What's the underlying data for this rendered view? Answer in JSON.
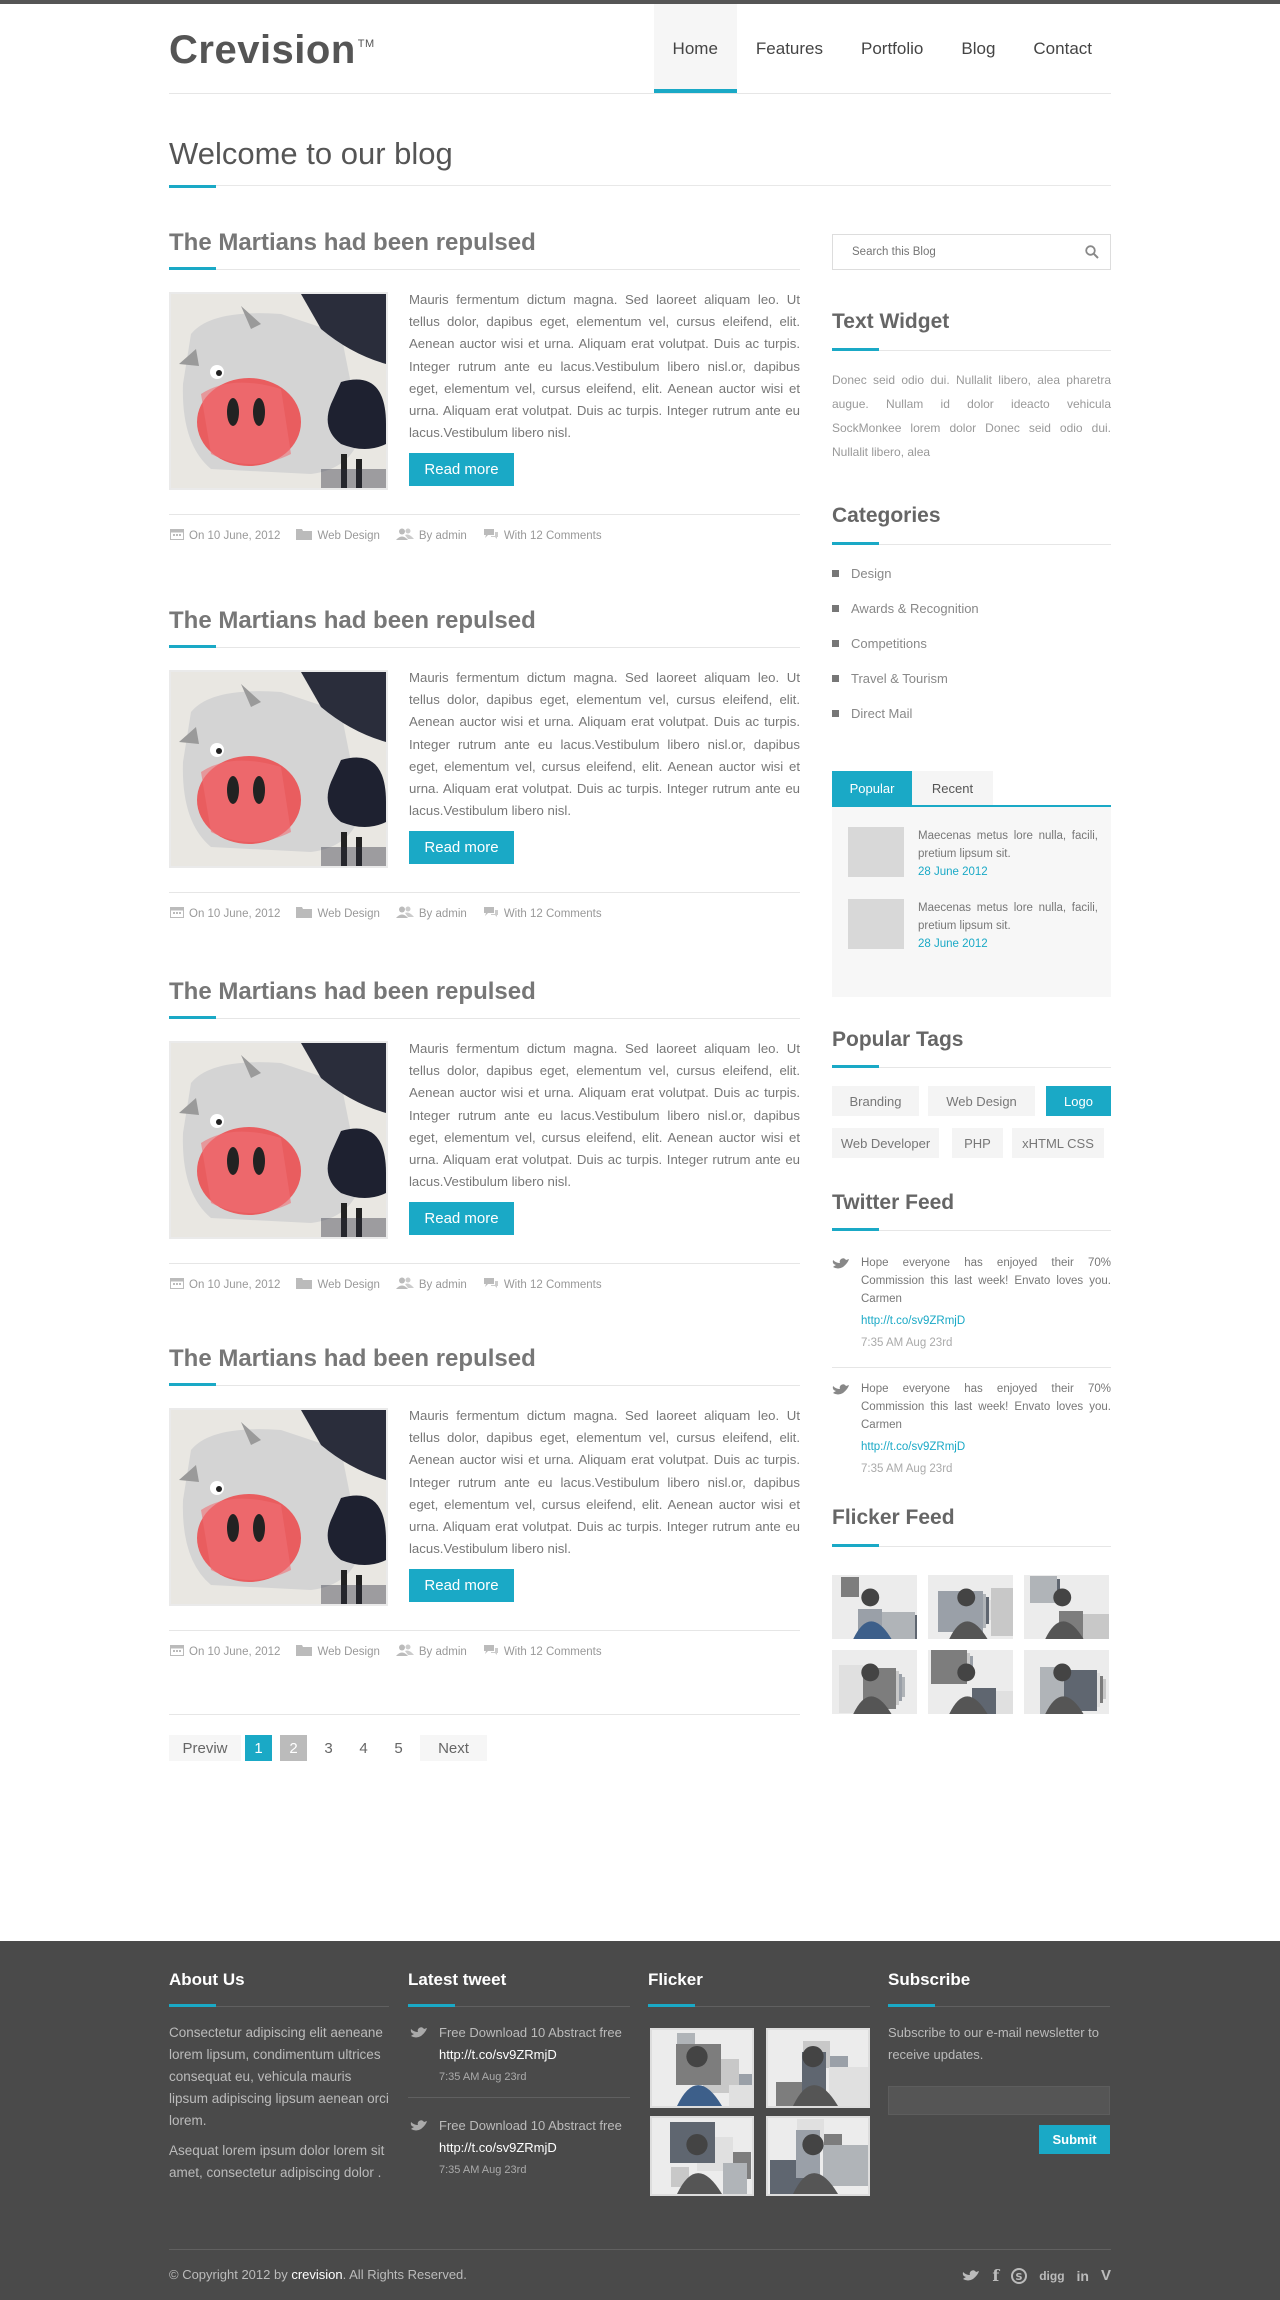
{
  "header": {
    "logo": "Crevision",
    "logo_tm": "TM",
    "nav": [
      "Home",
      "Features",
      "Portfolio",
      "Blog",
      "Contact"
    ],
    "active_nav": "Home"
  },
  "page": {
    "title": "Welcome to our blog"
  },
  "posts": [
    {
      "title": "The Martians had been repulsed",
      "excerpt": "Mauris fermentum dictum magna. Sed laoreet aliquam leo. Ut tellus dolor, dapibus eget, elementum vel, cursus eleifend, elit. Aenean auctor wisi et urna. Aliquam erat volutpat. Duis ac turpis. Integer rutrum ante eu lacus.Vestibulum libero nisl.or, dapibus eget, elementum vel, cursus eleifend, elit. Aenean auctor wisi et urna. Aliquam erat volutpat. Duis ac turpis. Integer rutrum ante eu lacus.Vestibulum libero nisl.",
      "button": "Read more",
      "date": "On 10 June, 2012",
      "category": "Web Design",
      "author": "By admin",
      "comments": "With 12 Comments"
    },
    {
      "title": "The Martians had been repulsed",
      "excerpt": "Mauris fermentum dictum magna. Sed laoreet aliquam leo. Ut tellus dolor, dapibus eget, elementum vel, cursus eleifend, elit. Aenean auctor wisi et urna. Aliquam erat volutpat. Duis ac turpis. Integer rutrum ante eu lacus.Vestibulum libero nisl.or, dapibus eget, elementum vel, cursus eleifend, elit. Aenean auctor wisi et urna. Aliquam erat volutpat. Duis ac turpis. Integer rutrum ante eu lacus.Vestibulum libero nisl.",
      "button": "Read more",
      "date": "On 10 June, 2012",
      "category": "Web Design",
      "author": "By admin",
      "comments": "With 12 Comments"
    },
    {
      "title": "The Martians had been repulsed",
      "excerpt": "Mauris fermentum dictum magna. Sed laoreet aliquam leo. Ut tellus dolor, dapibus eget, elementum vel, cursus eleifend, elit. Aenean auctor wisi et urna. Aliquam erat volutpat. Duis ac turpis. Integer rutrum ante eu lacus.Vestibulum libero nisl.or, dapibus eget, elementum vel, cursus eleifend, elit. Aenean auctor wisi et urna. Aliquam erat volutpat. Duis ac turpis. Integer rutrum ante eu lacus.Vestibulum libero nisl.",
      "button": "Read more",
      "date": "On 10 June, 2012",
      "category": "Web Design",
      "author": "By admin",
      "comments": "With 12 Comments"
    },
    {
      "title": "The Martians had been repulsed",
      "excerpt": "Mauris fermentum dictum magna. Sed laoreet aliquam leo. Ut tellus dolor, dapibus eget, elementum vel, cursus eleifend, elit. Aenean auctor wisi et urna. Aliquam erat volutpat. Duis ac turpis. Integer rutrum ante eu lacus.Vestibulum libero nisl.or, dapibus eget, elementum vel, cursus eleifend, elit. Aenean auctor wisi et urna. Aliquam erat volutpat. Duis ac turpis. Integer rutrum ante eu lacus.Vestibulum libero nisl.",
      "button": "Read more",
      "date": "On 10 June, 2012",
      "category": "Web Design",
      "author": "By admin",
      "comments": "With 12 Comments"
    }
  ],
  "pagination": {
    "prev": "Previw",
    "pages": [
      "1",
      "2",
      "3",
      "4",
      "5"
    ],
    "next": "Next",
    "current": "1"
  },
  "sidebar": {
    "search_placeholder": "Search this Blog",
    "text_widget": {
      "title": "Text Widget",
      "body": "Donec seid odio dui. Nullalit libero, alea pharetra augue. Nullam id dolor ideacto vehicula SockMonkee lorem dolor Donec seid odio dui. Nullalit libero, alea"
    },
    "categories": {
      "title": "Categories",
      "items": [
        "Design",
        "Awards & Recognition",
        "Competitions",
        "Travel & Tourism",
        "Direct Mail"
      ]
    },
    "tabs": {
      "labels": [
        "Popular",
        "Recent"
      ],
      "posts": [
        {
          "text": "Maecenas metus lore nulla, facili, pretium lipsum sit.",
          "date": "28 June 2012"
        },
        {
          "text": "Maecenas metus lore nulla, facili, pretium lipsum sit.",
          "date": "28 June 2012"
        }
      ]
    },
    "tags": {
      "title": "Popular Tags",
      "items": [
        "Branding",
        "Web Design",
        "Logo",
        "Web Developer",
        "PHP",
        "xHTML CSS"
      ],
      "active": "Logo"
    },
    "twitter": {
      "title": "Twitter Feed",
      "items": [
        {
          "text": "Hope everyone has enjoyed their 70% Commission this last week! Envato loves you. Carmen",
          "link": "http://t.co/sv9ZRmjD",
          "time": "7:35 AM Aug 23rd"
        },
        {
          "text": "Hope everyone has enjoyed their 70% Commission this last week! Envato loves you. Carmen",
          "link": "http://t.co/sv9ZRmjD",
          "time": "7:35 AM Aug 23rd"
        }
      ]
    },
    "flicker": {
      "title": "Flicker Feed"
    }
  },
  "footer": {
    "about": {
      "title": "About Us",
      "p1": "Consectetur adipiscing elit aeneane lorem lipsum, condimentum ultrices consequat eu, vehicula mauris lipsum adipiscing lipsum aenean orci lorem.",
      "p2": "Asequat lorem ipsum dolor lorem sit amet, consectetur adipiscing dolor ."
    },
    "tweets": {
      "title": "Latest tweet",
      "items": [
        {
          "text": "Free Download 10 Abstract free",
          "link": "http://t.co/sv9ZRmjD",
          "time": "7:35 AM Aug 23rd"
        },
        {
          "text": "Free Download 10 Abstract free",
          "link": "http://t.co/sv9ZRmjD",
          "time": "7:35 AM Aug 23rd"
        }
      ]
    },
    "flicker": {
      "title": "Flicker"
    },
    "subscribe": {
      "title": "Subscribe",
      "text": "Subscribe to our e-mail newsletter to receive updates.",
      "button": "Submit"
    },
    "copyright_pre": "© Copyright 2012 by",
    "copyright_brand": "crevision",
    "copyright_post": ". All Rights Reserved.",
    "social": [
      "twitter-icon",
      "facebook-icon",
      "skype-icon",
      "digg-icon",
      "linkedin-icon",
      "vimeo-icon"
    ]
  },
  "colors": {
    "accent": "#1aa9c6",
    "footer_bg": "#4a4a4a",
    "text": "#777777"
  }
}
